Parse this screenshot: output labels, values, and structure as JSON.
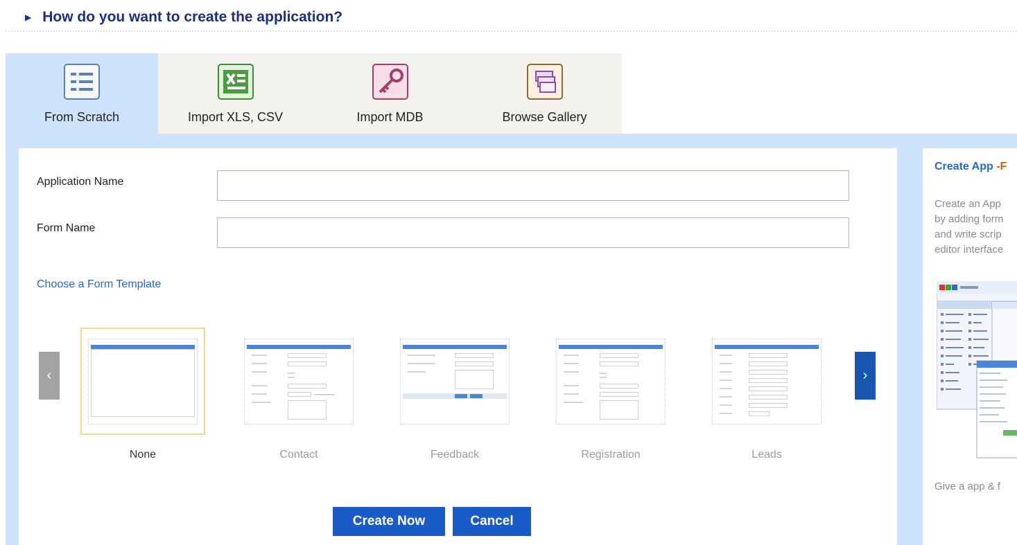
{
  "header": {
    "title": "How do you want to create the application?"
  },
  "tabs": [
    {
      "label": "From Scratch",
      "icon": "form-list-icon",
      "active": true
    },
    {
      "label": "Import XLS, CSV",
      "icon": "excel-icon",
      "active": false
    },
    {
      "label": "Import MDB",
      "icon": "access-key-icon",
      "active": false
    },
    {
      "label": "Browse Gallery",
      "icon": "gallery-stack-icon",
      "active": false
    }
  ],
  "form": {
    "app_name_label": "Application Name",
    "app_name_value": "",
    "form_name_label": "Form Name",
    "form_name_value": "",
    "choose_template": "Choose a Form Template"
  },
  "templates": [
    {
      "name": "None",
      "selected": true
    },
    {
      "name": "Contact",
      "selected": false
    },
    {
      "name": "Feedback",
      "selected": false
    },
    {
      "name": "Registration",
      "selected": false
    },
    {
      "name": "Leads",
      "selected": false
    }
  ],
  "buttons": {
    "create": "Create Now",
    "cancel": "Cancel"
  },
  "side": {
    "title": "Create App",
    "title_suffix": "-F",
    "desc_lines": [
      "Create an App",
      "by adding form",
      "and write scrip",
      "editor interface"
    ],
    "footer": "Give a app & f"
  },
  "colors": {
    "accent": "#1a5cc7",
    "band": "#cfe2fb",
    "header": "#1c2f7a",
    "link": "#2a66c4"
  }
}
